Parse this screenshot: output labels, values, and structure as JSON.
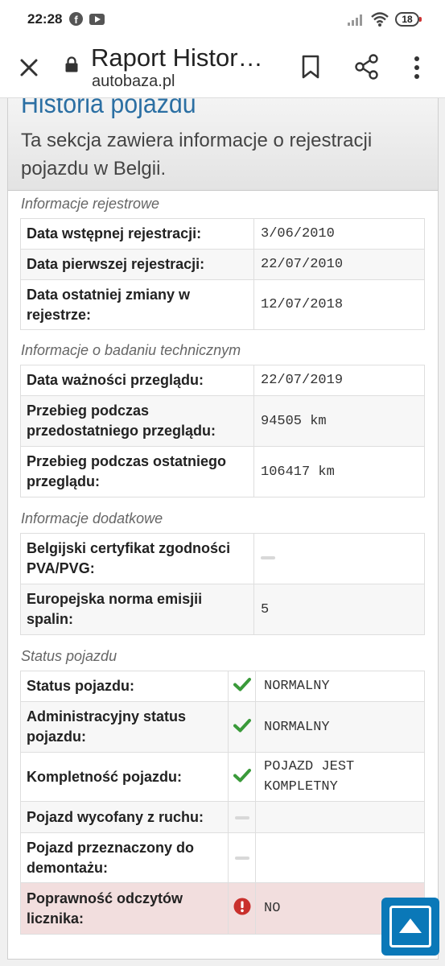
{
  "status_bar": {
    "time": "22:28",
    "icons": [
      "facebook-icon",
      "youtube-icon",
      "signal-icon",
      "wifi-icon"
    ],
    "battery": "18"
  },
  "browser": {
    "title": "Raport Histor…",
    "url": "autobaza.pl",
    "icons": [
      "close-icon",
      "lock-icon",
      "bookmark-icon",
      "share-icon",
      "more-vert-icon"
    ]
  },
  "card": {
    "title": "Historia pojazdu",
    "description": "Ta sekcja zawiera informacje o rejestracji pojazdu w Belgii."
  },
  "sections": {
    "registration": {
      "label": "Informacje rejestrowe",
      "rows": [
        {
          "key": "Data wstępnej rejestracji:",
          "value": "3/06/2010"
        },
        {
          "key": "Data pierwszej rejestracji:",
          "value": "22/07/2010"
        },
        {
          "key": "Data ostatniej zmiany w rejestrze:",
          "value": "12/07/2018"
        }
      ]
    },
    "inspection": {
      "label": "Informacje o badaniu technicznym",
      "rows": [
        {
          "key": "Data ważności przeglądu:",
          "value": "22/07/2019"
        },
        {
          "key": "Przebieg podczas przedostatniego przeglądu:",
          "value": "94505 km"
        },
        {
          "key": "Przebieg podczas ostatniego przeglądu:",
          "value": "106417 km"
        }
      ]
    },
    "additional": {
      "label": "Informacje dodatkowe",
      "rows": [
        {
          "key": "Belgijski certyfikat zgodności PVA/PVG:",
          "value": ""
        },
        {
          "key": "Europejska norma emisjii spalin:",
          "value": "5"
        }
      ]
    },
    "status": {
      "label": "Status pojazdu",
      "rows": [
        {
          "key": "Status pojazdu:",
          "icon": "check-icon",
          "value": "NORMALNY"
        },
        {
          "key": "Administracyjny status pojazdu:",
          "icon": "check-icon",
          "value": "NORMALNY"
        },
        {
          "key": "Kompletność pojazdu:",
          "icon": "check-icon",
          "value": "POJAZD JEST KOMPLETNY"
        },
        {
          "key": "Pojazd wycofany z ruchu:",
          "icon": "dash-icon",
          "value": ""
        },
        {
          "key": "Pojazd przeznaczony do demontażu:",
          "icon": "dash-icon",
          "value": ""
        },
        {
          "key": "Poprawność odczytów licznika:",
          "icon": "exclamation-icon",
          "value": "NO"
        }
      ]
    }
  },
  "colors": {
    "title_blue": "#2b6fa3",
    "check_green": "#3a9a3a",
    "error_red": "#c9302c",
    "danger_row_bg": "#f2dede",
    "scroll_button": "#0a78b8"
  }
}
